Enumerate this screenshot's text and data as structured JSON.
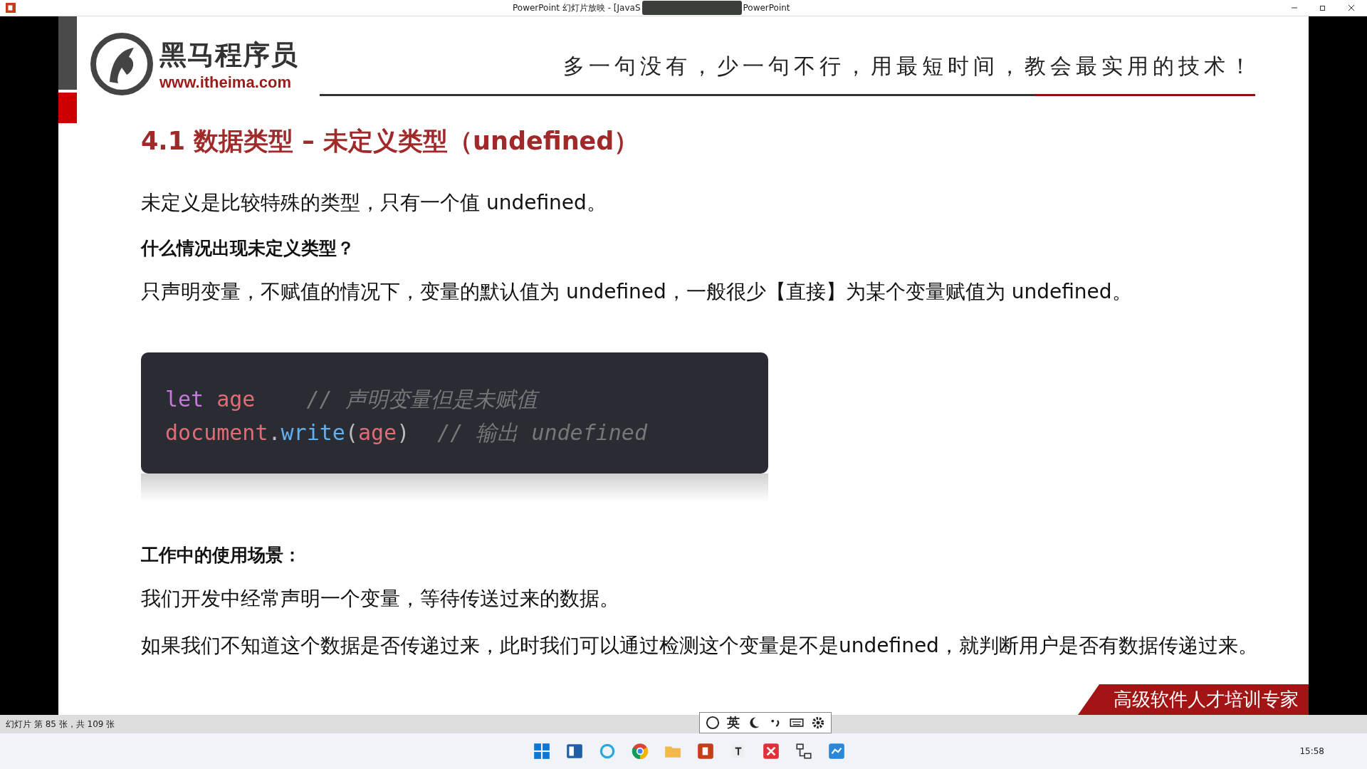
{
  "window": {
    "title_left": "PowerPoint 幻灯片放映 - [JavaS",
    "title_right": "PowerPoint"
  },
  "slide": {
    "logo": {
      "name": "黑马程序员",
      "url": "www.itheima.com"
    },
    "tagline": "多一句没有，少一句不行，用最短时间，教会最实用的技术！",
    "title": "4.1 数据类型 – 未定义类型（undefined）",
    "paragraphs": [
      {
        "kind": "text",
        "text": "未定义是比较特殊的类型，只有一个值 undefined。"
      },
      {
        "kind": "heading",
        "text": "什么情况出现未定义类型？"
      },
      {
        "kind": "text",
        "text": "只声明变量，不赋值的情况下，变量的默认值为 undefined，一般很少【直接】为某个变量赋值为 undefined。"
      }
    ],
    "code": [
      [
        {
          "kind": "keyword",
          "text": "let"
        },
        {
          "kind": "variable",
          "text": "age"
        },
        {
          "kind": "comment",
          "text": "// 声明变量但是未赋值"
        }
      ],
      [
        {
          "kind": "variable",
          "text": "document"
        },
        {
          "kind": "plain",
          "text": "."
        },
        {
          "kind": "function",
          "text": "write"
        },
        {
          "kind": "plain",
          "text": "("
        },
        {
          "kind": "variable",
          "text": "age"
        },
        {
          "kind": "plain",
          "text": ")"
        },
        {
          "kind": "comment",
          "text": "// 输出 undefined"
        }
      ]
    ],
    "usage": [
      {
        "kind": "heading",
        "text": "工作中的使用场景："
      },
      {
        "kind": "text",
        "text": "我们开发中经常声明一个变量，等待传送过来的数据。"
      },
      {
        "kind": "text",
        "text": "如果我们不知道这个数据是否传递过来，此时我们可以通过检测这个变量是不是undefined，就判断用户是否有数据传递过来。"
      }
    ],
    "banner": "高级软件人才培训专家"
  },
  "status_bar": {
    "slide_info": "幻灯片 第 85 张，共 109 张"
  },
  "ime": {
    "mode": "英"
  },
  "taskbar": {
    "time": "15:58"
  }
}
